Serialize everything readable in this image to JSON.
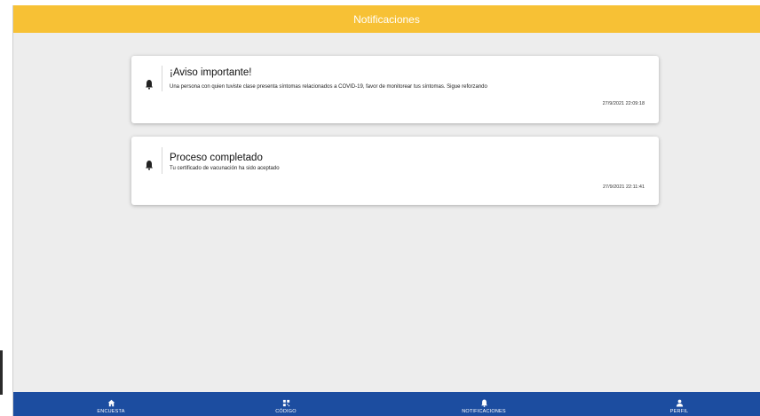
{
  "header": {
    "title": "Notificaciones"
  },
  "notifications": [
    {
      "icon": "bell-icon",
      "title": "¡Aviso importante!",
      "message": "Una persona con quien tuviste clase presenta síntomas relacionados a COVID-19, favor de monitorear tus síntomas. Sigue reforzando",
      "timestamp": "27/9/2021 22:09:18"
    },
    {
      "icon": "bell-icon",
      "title": "Proceso completado",
      "message": "Tu certificado de vacunación ha sido aceptado",
      "timestamp": "27/9/2021 22:11:41"
    }
  ],
  "bottom_nav": {
    "items": [
      {
        "label": "ENCUESTA",
        "icon": "home-icon"
      },
      {
        "label": "CÓDIGO",
        "icon": "qr-code-icon"
      },
      {
        "label": "NOTIFICACIONES",
        "icon": "bell-icon"
      },
      {
        "label": "PERFIL",
        "icon": "person-icon"
      }
    ]
  },
  "colors": {
    "header": "#f7c135",
    "bottom_nav": "#1c4da0",
    "background": "#ededed"
  }
}
